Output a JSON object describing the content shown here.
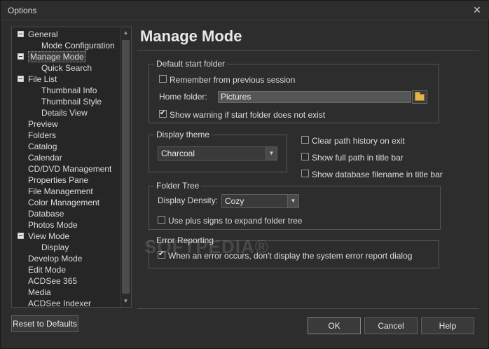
{
  "window": {
    "title": "Options",
    "close_glyph": "✕"
  },
  "tree": {
    "items": [
      {
        "label": "General",
        "expander": true
      },
      {
        "label": "Mode Configuration",
        "expander": false
      },
      {
        "label": "Manage Mode",
        "expander": true,
        "selected": true
      },
      {
        "label": "Quick Search",
        "expander": false
      },
      {
        "label": "File List",
        "expander": true
      },
      {
        "label": "Thumbnail Info",
        "expander": false
      },
      {
        "label": "Thumbnail Style",
        "expander": false
      },
      {
        "label": "Details View",
        "expander": false
      },
      {
        "label": "Preview",
        "expander": false
      },
      {
        "label": "Folders",
        "expander": false
      },
      {
        "label": "Catalog",
        "expander": false
      },
      {
        "label": "Calendar",
        "expander": false
      },
      {
        "label": "CD/DVD Management",
        "expander": false
      },
      {
        "label": "Properties Pane",
        "expander": false
      },
      {
        "label": "File Management",
        "expander": false
      },
      {
        "label": "Color Management",
        "expander": false
      },
      {
        "label": "Database",
        "expander": false
      },
      {
        "label": "Photos Mode",
        "expander": false
      },
      {
        "label": "View Mode",
        "expander": true
      },
      {
        "label": "Display",
        "expander": false
      },
      {
        "label": "Develop Mode",
        "expander": false
      },
      {
        "label": "Edit Mode",
        "expander": false
      },
      {
        "label": "ACDSee 365",
        "expander": false
      },
      {
        "label": "Media",
        "expander": false
      },
      {
        "label": "ACDSee Indexer",
        "expander": false
      }
    ]
  },
  "page": {
    "title": "Manage Mode",
    "default_start_folder": {
      "group_title": "Default start folder",
      "remember_label": "Remember from previous session",
      "remember_checked": false,
      "home_folder_label": "Home folder:",
      "home_folder_value": "Pictures",
      "show_warning_label": "Show warning if start folder does not exist",
      "show_warning_checked": true
    },
    "display_theme": {
      "group_title": "Display theme",
      "selected": "Charcoal"
    },
    "options": {
      "clear_path_history_label": "Clear path history on exit",
      "clear_path_history_checked": false,
      "show_full_path_label": "Show full path in title bar",
      "show_full_path_checked": false,
      "show_db_filename_label": "Show database filename in title bar",
      "show_db_filename_checked": false
    },
    "folder_tree": {
      "group_title": "Folder Tree",
      "density_label": "Display Density:",
      "density_selected": "Cozy",
      "plus_signs_label": "Use plus signs to expand folder tree",
      "plus_signs_checked": false
    },
    "error_reporting": {
      "group_title": "Error Reporting",
      "dont_display_label": "When an error occurs, don't display the system error report dialog",
      "dont_display_checked": true
    }
  },
  "buttons": {
    "reset": "Reset to Defaults",
    "ok": "OK",
    "cancel": "Cancel",
    "help": "Help"
  },
  "watermark": "SOFTPEDIA®"
}
